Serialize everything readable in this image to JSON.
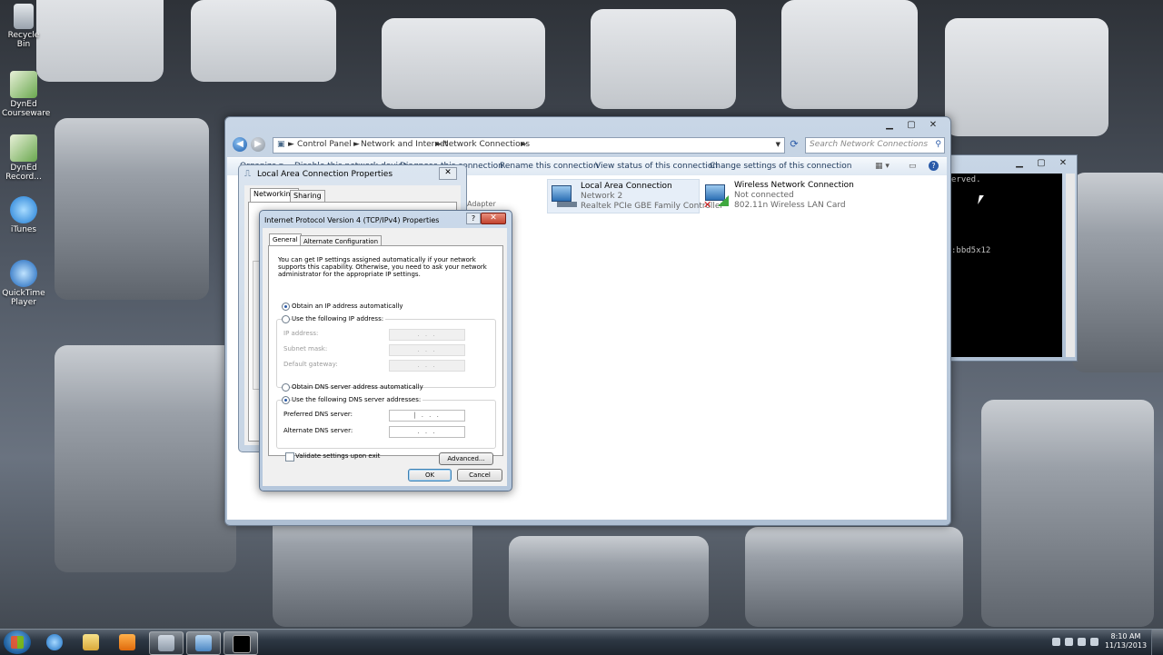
{
  "desktop": {
    "icons": [
      {
        "label_l1": "Recycle Bin",
        "label_l2": ""
      },
      {
        "label_l1": "DynEd",
        "label_l2": "Courseware"
      },
      {
        "label_l1": "DynEd",
        "label_l2": "Record..."
      },
      {
        "label_l1": "iTunes",
        "label_l2": ""
      },
      {
        "label_l1": "QuickTime",
        "label_l2": "Player"
      }
    ]
  },
  "explorer": {
    "breadcrumb_sep": "►",
    "breadcrumb": [
      "Control Panel",
      "Network and Internet",
      "Network Connections"
    ],
    "search_placeholder": "Search Network Connections",
    "commands": {
      "organize": "Organize ▾",
      "disable": "Disable this network device",
      "diagnose": "Diagnose this connection",
      "rename": "Rename this connection",
      "view_status": "View status of this connection",
      "change_settings": "Change settings of this connection"
    },
    "connections": [
      {
        "name": "Local Area Connection",
        "network": "Network 2",
        "adapter": "Realtek PCIe GBE Family Controller"
      },
      {
        "name": "Wireless Network Connection",
        "network": "Not connected",
        "adapter": "802.11n Wireless LAN Card"
      }
    ],
    "partial_adapter_text": "Adapter"
  },
  "cmd": {
    "lines": [
      "erved.",
      "",
      "",
      "",
      "",
      "",
      "",
      ":bbd5x12"
    ]
  },
  "lan_dialog": {
    "title": "Local Area Connection Properties",
    "tabs": [
      "Networking",
      "Sharing"
    ]
  },
  "ipv4_dialog": {
    "title": "Internet Protocol Version 4 (TCP/IPv4) Properties",
    "tabs": [
      "General",
      "Alternate Configuration"
    ],
    "intro": "You can get IP settings assigned automatically if your network supports this capability. Otherwise, you need to ask your network administrator for the appropriate IP settings.",
    "ip_mode": {
      "auto_label": "Obtain an IP address automatically",
      "manual_label": "Use the following IP address:",
      "selected": "auto"
    },
    "ip_fields": [
      {
        "label": "IP address:",
        "value": ".   .   ."
      },
      {
        "label": "Subnet mask:",
        "value": ".   .   ."
      },
      {
        "label": "Default gateway:",
        "value": ".   .   ."
      }
    ],
    "dns_mode": {
      "auto_label": "Obtain DNS server address automatically",
      "manual_label": "Use the following DNS server addresses:",
      "selected": "manual"
    },
    "dns_fields": [
      {
        "label": "Preferred DNS server:",
        "value": "|   .   .   ."
      },
      {
        "label": "Alternate DNS server:",
        "value": ".   .   ."
      }
    ],
    "validate_label": "Validate settings upon exit",
    "advanced_label": "Advanced...",
    "ok_label": "OK",
    "cancel_label": "Cancel"
  },
  "taskbar": {
    "time": "8:10 AM",
    "date": "11/13/2013"
  }
}
